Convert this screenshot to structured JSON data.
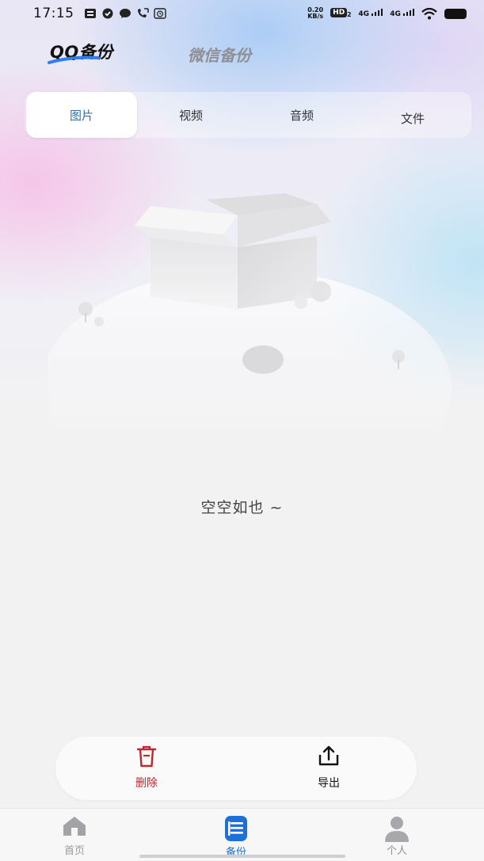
{
  "status_bar": {
    "time": "17:15",
    "speed_value": "0.20",
    "speed_unit": "KB/s",
    "hd_badge": "HD",
    "hd_sub": "2",
    "network_1": "4G",
    "network_2": "4G",
    "icons": [
      "notification-icon",
      "check-icon",
      "message-icon",
      "call-icon",
      "alarm-icon",
      "wifi-icon",
      "battery-icon"
    ]
  },
  "header": {
    "qq_tab": "QQ备份",
    "wechat_tab": "微信备份"
  },
  "categories": {
    "items": [
      "图片",
      "视频",
      "音频",
      "文件"
    ],
    "active_index": 0
  },
  "empty_state": {
    "message": "空空如也 ~"
  },
  "actions": {
    "delete_label": "删除",
    "export_label": "导出"
  },
  "bottom_nav": {
    "home_label": "首页",
    "backup_label": "备份",
    "profile_label": "个人",
    "active": "backup"
  },
  "colors": {
    "accent_blue": "#1f6fd9",
    "tab_active_text": "#2f6fae",
    "delete_red": "#c0262d",
    "nav_inactive": "#9a9a9e"
  }
}
